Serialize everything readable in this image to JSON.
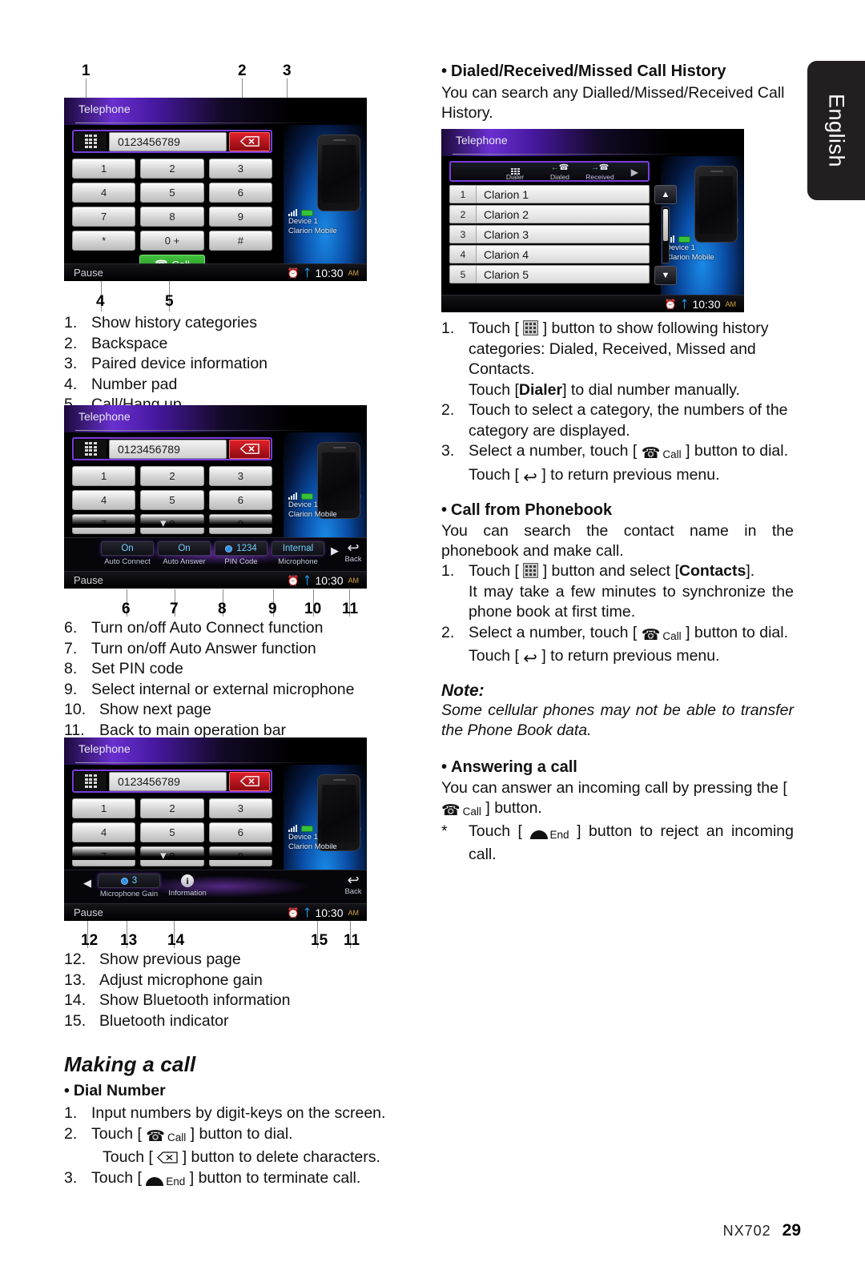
{
  "page": {
    "language_tab": "English",
    "footer_model": "NX702",
    "footer_page": "29"
  },
  "left_column": {
    "callouts_top": [
      "1",
      "2",
      "3",
      "4",
      "5"
    ],
    "list_1_5": [
      {
        "num": "1.",
        "text": "Show history categories"
      },
      {
        "num": "2.",
        "text": "Backspace"
      },
      {
        "num": "3.",
        "text": "Paired device information"
      },
      {
        "num": "4.",
        "text": "Number pad"
      },
      {
        "num": "5.",
        "text": "Call/Hang up"
      }
    ],
    "callouts_mid": [
      "6",
      "7",
      "8",
      "9",
      "10",
      "11"
    ],
    "list_6_11": [
      {
        "num": "6.",
        "text": "Turn on/off Auto Connect function"
      },
      {
        "num": "7.",
        "text": "Turn on/off Auto Answer function"
      },
      {
        "num": "8.",
        "text": "Set PIN code"
      },
      {
        "num": "9.",
        "text": "Select internal or external microphone"
      },
      {
        "num": "10.",
        "text": "Show next page"
      },
      {
        "num": "11.",
        "text": "Back to main operation bar"
      }
    ],
    "callouts_bottom": [
      "12",
      "13",
      "14",
      "15",
      "11"
    ],
    "list_12_15": [
      {
        "num": "12.",
        "text": "Show previous page"
      },
      {
        "num": "13.",
        "text": "Adjust microphone gain"
      },
      {
        "num": "14.",
        "text": "Show Bluetooth information"
      },
      {
        "num": "15.",
        "text": "Bluetooth indicator"
      }
    ],
    "making_a_call": {
      "heading": "Making a call",
      "dial_number_heading": "Dial Number",
      "step1_num": "1.",
      "step1_text": "Input numbers by digit-keys on the screen.",
      "step2_num": "2.",
      "step2_before": "Touch [",
      "step2_after": "] button to dial.",
      "step2b_before": "Touch [",
      "step2b_after": "] button to delete characters.",
      "step3_num": "3.",
      "step3_before": "Touch [",
      "step3_after": "] button to terminate call."
    }
  },
  "right_column": {
    "history": {
      "heading": "Dialed/Received/Missed Call History",
      "intro": "You can search any Dialled/Missed/Received Call History.",
      "step1_num": "1.",
      "step1_a": "Touch [",
      "step1_b": "] button to show following history categories: Dialed, Received, Missed and Contacts.",
      "step1_sub_a": "Touch [",
      "step1_sub_bold": "Dialer",
      "step1_sub_b": "] to dial number manually.",
      "step2_num": "2.",
      "step2_text": "Touch to select a category, the numbers of the category are displayed.",
      "step3_num": "3.",
      "step3_a": "Select a number, touch [",
      "step3_b": "] button to dial.",
      "step3_sub_a": "Touch [",
      "step3_sub_b": "] to return previous menu."
    },
    "phonebook": {
      "heading": "Call from Phonebook",
      "intro": "You can search the contact name in the phonebook and make call.",
      "step1_num": "1.",
      "step1_a": "Touch [",
      "step1_b": "] button and select [",
      "step1_bold": "Contacts",
      "step1_c": "].",
      "step1_sub": "It may take a few minutes to synchronize the phone book at first time.",
      "step2_num": "2.",
      "step2_a": "Select a number, touch [",
      "step2_b": "] button to dial.",
      "step2_sub_a": "Touch [",
      "step2_sub_b": "] to return previous menu."
    },
    "note": {
      "heading": "Note:",
      "body": "Some cellular phones may not be able to transfer the Phone Book data."
    },
    "answering": {
      "heading": "Answering a call",
      "line1_a": "You can answer an incoming call by pressing the [",
      "line1_b": "] button.",
      "star": "*",
      "star_a": "Touch [",
      "star_b": "] button to reject an incoming call."
    }
  },
  "screens": {
    "dialer": {
      "title": "Telephone",
      "number_value": "0123456789",
      "keys": [
        "1",
        "2",
        "3",
        "4",
        "5",
        "6",
        "7",
        "8",
        "9",
        "*",
        "0 +",
        "#"
      ],
      "call_label": "Call",
      "status_left": "Pause",
      "clock": "10:30",
      "clock_suffix": "AM",
      "device_name": "Device 1",
      "device_model": "Clarion Mobile",
      "device_index": "1"
    },
    "settings_bar_1": {
      "items": [
        {
          "value": "On",
          "label": "Auto Connect"
        },
        {
          "value": "On",
          "label": "Auto Answer"
        },
        {
          "value": "1234",
          "label": "PIN Code"
        },
        {
          "value": "Internal",
          "label": "Microphone"
        }
      ],
      "next_label": "",
      "back_label": "Back"
    },
    "settings_bar_2": {
      "mic_gain_value": "3",
      "mic_gain_label": "Microphone Gain",
      "information_label": "Information",
      "back_label": "Back"
    },
    "history_list": {
      "title": "Telephone",
      "tabs": [
        {
          "label": "Dialer",
          "icon": "keypad-icon"
        },
        {
          "label": "Dialed",
          "icon": "arrow-in-call-icon"
        },
        {
          "label": "Received",
          "icon": "arrow-out-call-icon"
        }
      ],
      "rows": [
        {
          "index": "1",
          "name": "Clarion 1"
        },
        {
          "index": "2",
          "name": "Clarion 2"
        },
        {
          "index": "3",
          "name": "Clarion 3"
        },
        {
          "index": "4",
          "name": "Clarion 4"
        },
        {
          "index": "5",
          "name": "Clarion 5"
        }
      ],
      "clock": "10:30",
      "clock_suffix": "AM",
      "device_name": "Device 1",
      "device_model": "Clarion Mobile",
      "device_index": "1"
    }
  },
  "colors": {
    "accent_purple": "#7a3ce0",
    "call_green": "#2fae2b",
    "backspace_red": "#c51a22",
    "bluetooth_blue": "#1f9bf0"
  }
}
